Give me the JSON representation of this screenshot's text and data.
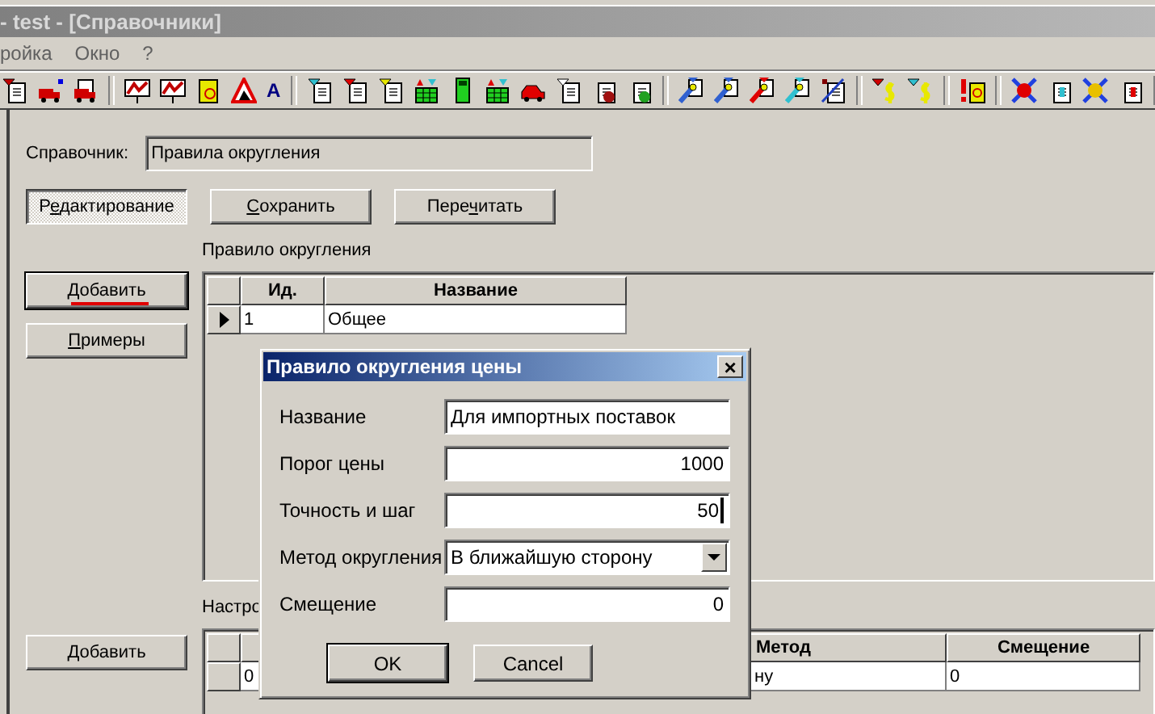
{
  "window": {
    "title": "- test - [Справочники]"
  },
  "menu": [
    "ройка",
    "Окно",
    "?"
  ],
  "toolbar": {
    "glyph": "A"
  },
  "directory": {
    "label": "Справочник:",
    "value": "Правила округления"
  },
  "actions": [
    {
      "pre": "Р",
      "key": "е",
      "post": "дактирование",
      "pressed": true
    },
    {
      "key": "С",
      "post": "охранить",
      "pressed": false
    },
    {
      "pre": "Пере",
      "key": "ч",
      "post": "итать",
      "pressed": false
    }
  ],
  "rules": {
    "title": "Правило округления",
    "columns": [
      "Ид.",
      "Название"
    ],
    "rows": [
      {
        "cells": [
          "1",
          "Общее"
        ],
        "current": true
      }
    ]
  },
  "side_buttons": [
    {
      "key": "Д",
      "post": "обавить",
      "default": true,
      "marked": true
    },
    {
      "key": "П",
      "post": "римеры",
      "default": false,
      "marked": false
    }
  ],
  "settings": {
    "title": "Настро",
    "columns": [
      null,
      "Метод",
      "Смещение"
    ],
    "rows": [
      {
        "cells": [
          "0",
          "ну",
          "0"
        ],
        "current": false
      }
    ]
  },
  "settings_button": {
    "label": "Добавить"
  },
  "dialog": {
    "title": "Правило округления цены",
    "close": "×",
    "fields": [
      {
        "kind": "text",
        "label": "Название",
        "value": "Для импортных поставок",
        "focused": false
      },
      {
        "kind": "number",
        "label": "Порог цены",
        "value": "1000",
        "focused": false
      },
      {
        "kind": "number",
        "label": "Точность и шаг",
        "value": "50",
        "focused": true
      },
      {
        "kind": "select",
        "label": "Метод округления",
        "value": "В ближайшую сторону",
        "focused": false
      },
      {
        "kind": "number",
        "label": "Смещение",
        "value": "0",
        "focused": false
      }
    ],
    "buttons": [
      {
        "label": "OK",
        "default": true
      },
      {
        "label": "Cancel",
        "default": false
      }
    ]
  }
}
